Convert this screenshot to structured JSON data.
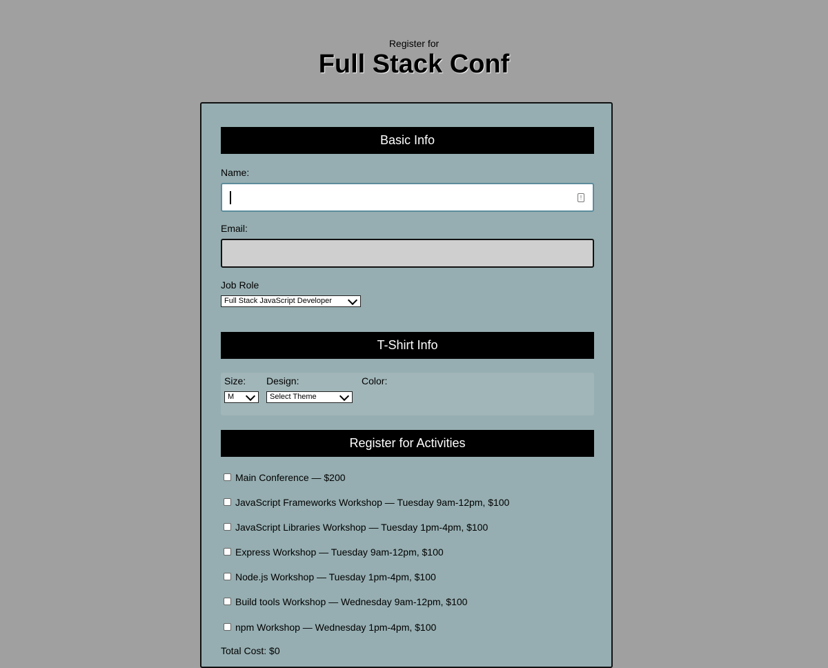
{
  "header": {
    "subtitle": "Register for",
    "title": "Full Stack Conf"
  },
  "basic_info": {
    "heading": "Basic Info",
    "name_label": "Name:",
    "name_value": "",
    "email_label": "Email:",
    "email_value": "",
    "job_role_label": "Job Role",
    "job_role_selected": "Full Stack JavaScript Developer"
  },
  "tshirt": {
    "heading": "T-Shirt Info",
    "size_label": "Size:",
    "size_selected": "M",
    "design_label": "Design:",
    "design_selected": "Select Theme",
    "color_label": "Color:"
  },
  "activities": {
    "heading": "Register for Activities",
    "items": [
      {
        "label": "Main Conference — $200",
        "checked": false
      },
      {
        "label": "JavaScript Frameworks Workshop — Tuesday 9am-12pm, $100",
        "checked": false
      },
      {
        "label": "JavaScript Libraries Workshop — Tuesday 1pm-4pm, $100",
        "checked": false
      },
      {
        "label": "Express Workshop — Tuesday 9am-12pm, $100",
        "checked": false
      },
      {
        "label": "Node.js Workshop — Tuesday 1pm-4pm, $100",
        "checked": false
      },
      {
        "label": "Build tools Workshop — Wednesday 9am-12pm, $100",
        "checked": false
      },
      {
        "label": "npm Workshop — Wednesday 1pm-4pm, $100",
        "checked": false
      }
    ],
    "total_cost": "Total Cost: $0"
  },
  "colors": {
    "page_background": "#a0a0a0",
    "form_background": "#96aeb1",
    "section_bar": "#000000",
    "section_text": "#ffffff",
    "email_field": "#cfcfcf",
    "name_field_border": "#5c8c9c"
  }
}
